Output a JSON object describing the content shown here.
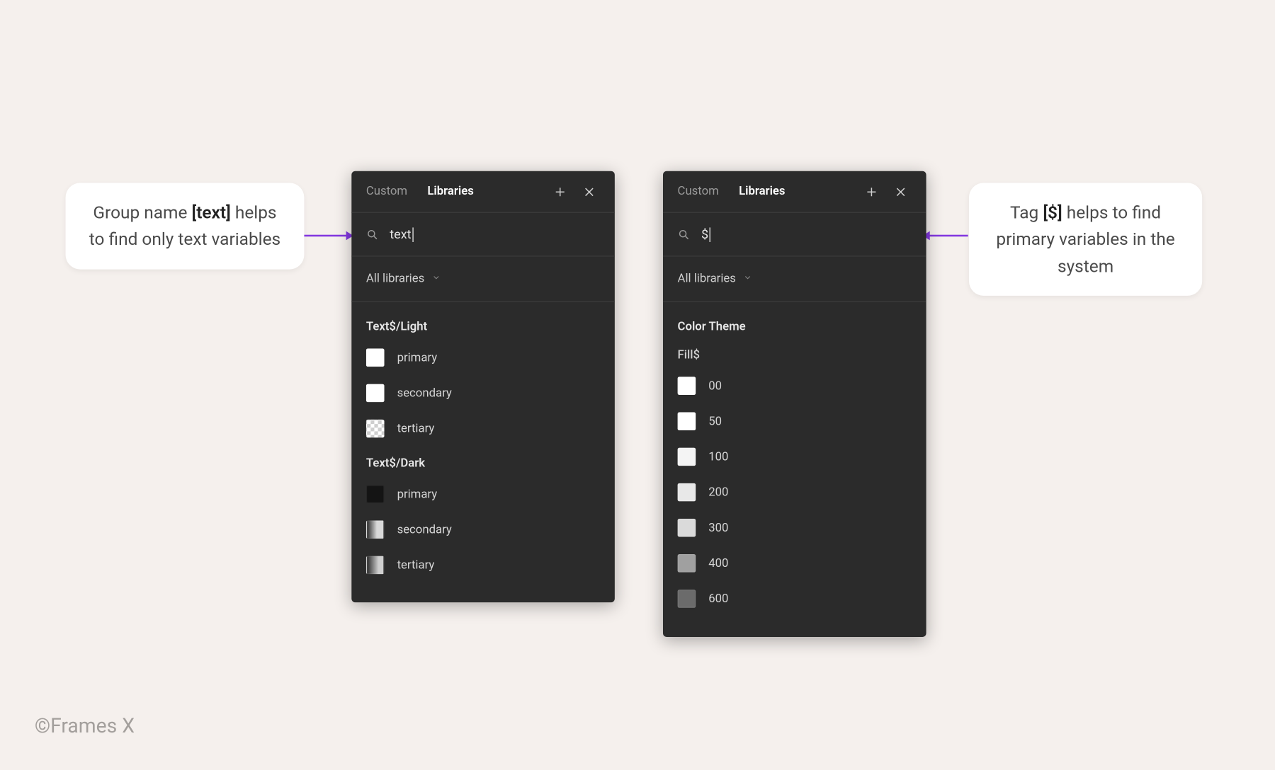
{
  "callouts": {
    "left": {
      "pre": "Group name ",
      "tag": "[text]",
      "post": " helps to find only text variables"
    },
    "right": {
      "pre": "Tag ",
      "tag": "[$]",
      "post": " helps to find primary variables in the system"
    }
  },
  "panel_left": {
    "tabs": {
      "custom": "Custom",
      "libraries": "Libraries"
    },
    "search_value": "text",
    "filter_label": "All libraries",
    "groups": [
      {
        "title": "Text$/Light",
        "items": [
          {
            "label": "primary",
            "swatch": "sw-white"
          },
          {
            "label": "secondary",
            "swatch": "sw-white"
          },
          {
            "label": "tertiary",
            "swatch": "sw-checker"
          }
        ]
      },
      {
        "title": "Text$/Dark",
        "items": [
          {
            "label": "primary",
            "swatch": "sw-black"
          },
          {
            "label": "secondary",
            "swatch": "sw-grad1"
          },
          {
            "label": "tertiary",
            "swatch": "sw-grad2"
          }
        ]
      }
    ]
  },
  "panel_right": {
    "tabs": {
      "custom": "Custom",
      "libraries": "Libraries"
    },
    "search_value": "$",
    "filter_label": "All libraries",
    "section_title": "Color Theme",
    "subgroup": "Fill$",
    "items": [
      {
        "label": "00",
        "swatch": "sw-white"
      },
      {
        "label": "50",
        "swatch": "sw-white"
      },
      {
        "label": "100",
        "swatch": "sw-sf4"
      },
      {
        "label": "200",
        "swatch": "sw-se8"
      },
      {
        "label": "300",
        "swatch": "sw-sda"
      },
      {
        "label": "400",
        "swatch": "sw-sa0"
      },
      {
        "label": "600",
        "swatch": "sw-s6b"
      }
    ]
  },
  "footer": "©Frames X"
}
